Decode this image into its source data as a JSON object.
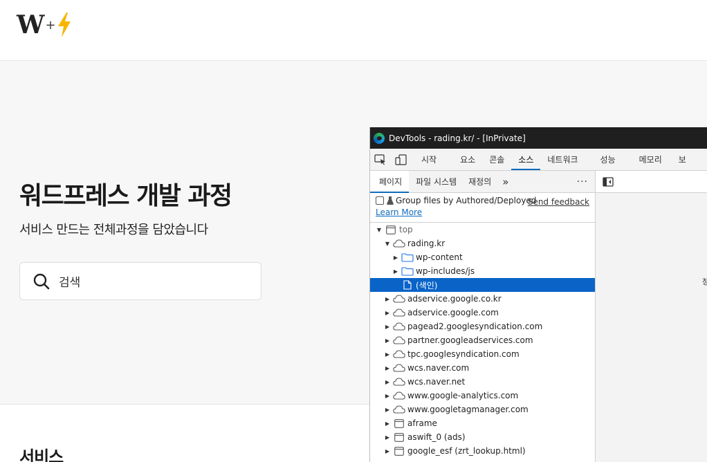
{
  "site": {
    "logo_letter": "W",
    "logo_plus": "+",
    "hero_title": "워드프레스 개발 과정",
    "hero_subtitle": "서비스 만드는 전체과정을 담았습니다",
    "search_placeholder": "검색",
    "section_title": "서비스"
  },
  "devtools": {
    "window_title": "DevTools - rading.kr/ - [InPrivate]",
    "tabs": [
      {
        "label": "시작"
      },
      {
        "label": "요소"
      },
      {
        "label": "콘솔"
      },
      {
        "label": "소스"
      },
      {
        "label": "네트워크"
      },
      {
        "label": "성능"
      },
      {
        "label": "메모리"
      },
      {
        "label": "보"
      }
    ],
    "active_tab": "소스",
    "nav_tabs": [
      {
        "label": "페이지"
      },
      {
        "label": "파일 시스템"
      },
      {
        "label": "재정의"
      }
    ],
    "nav_more": "»",
    "nav_kebab": "⋮",
    "group_files_label": "Group files by Authored/Deployed",
    "group_files_checked": false,
    "send_feedback": "Send feedback",
    "learn_more": "Learn More",
    "right_panel_text": "정",
    "tree": [
      {
        "label": "top",
        "depth": 0,
        "icon": "frame-icon",
        "expanded": true,
        "twisty": "▼"
      },
      {
        "label": "rading.kr",
        "depth": 1,
        "icon": "cloud-icon",
        "expanded": true,
        "twisty": "▼"
      },
      {
        "label": "wp-content",
        "depth": 2,
        "icon": "folder-icon",
        "twisty": "▶"
      },
      {
        "label": "wp-includes/js",
        "depth": 2,
        "icon": "folder-icon",
        "twisty": "▶"
      },
      {
        "label": "(색인)",
        "depth": 2,
        "icon": "file-icon",
        "twisty": "",
        "selected": true
      },
      {
        "label": "adservice.google.co.kr",
        "depth": 1,
        "icon": "cloud-icon",
        "twisty": "▶"
      },
      {
        "label": "adservice.google.com",
        "depth": 1,
        "icon": "cloud-icon",
        "twisty": "▶"
      },
      {
        "label": "pagead2.googlesyndication.com",
        "depth": 1,
        "icon": "cloud-icon",
        "twisty": "▶"
      },
      {
        "label": "partner.googleadservices.com",
        "depth": 1,
        "icon": "cloud-icon",
        "twisty": "▶"
      },
      {
        "label": "tpc.googlesyndication.com",
        "depth": 1,
        "icon": "cloud-icon",
        "twisty": "▶"
      },
      {
        "label": "wcs.naver.com",
        "depth": 1,
        "icon": "cloud-icon",
        "twisty": "▶"
      },
      {
        "label": "wcs.naver.net",
        "depth": 1,
        "icon": "cloud-icon",
        "twisty": "▶"
      },
      {
        "label": "www.google-analytics.com",
        "depth": 1,
        "icon": "cloud-icon",
        "twisty": "▶"
      },
      {
        "label": "www.googletagmanager.com",
        "depth": 1,
        "icon": "cloud-icon",
        "twisty": "▶"
      },
      {
        "label": "aframe",
        "depth": 1,
        "icon": "frame-icon",
        "twisty": "▶"
      },
      {
        "label": "aswift_0 (ads)",
        "depth": 1,
        "icon": "frame-icon",
        "twisty": "▶"
      },
      {
        "label": "google_esf (zrt_lookup.html)",
        "depth": 1,
        "icon": "frame-icon",
        "twisty": "▶"
      }
    ],
    "colors": {
      "accent": "#0f6cbd",
      "selected_row": "#0a64c8",
      "titlebar": "#1f1f1f"
    }
  }
}
